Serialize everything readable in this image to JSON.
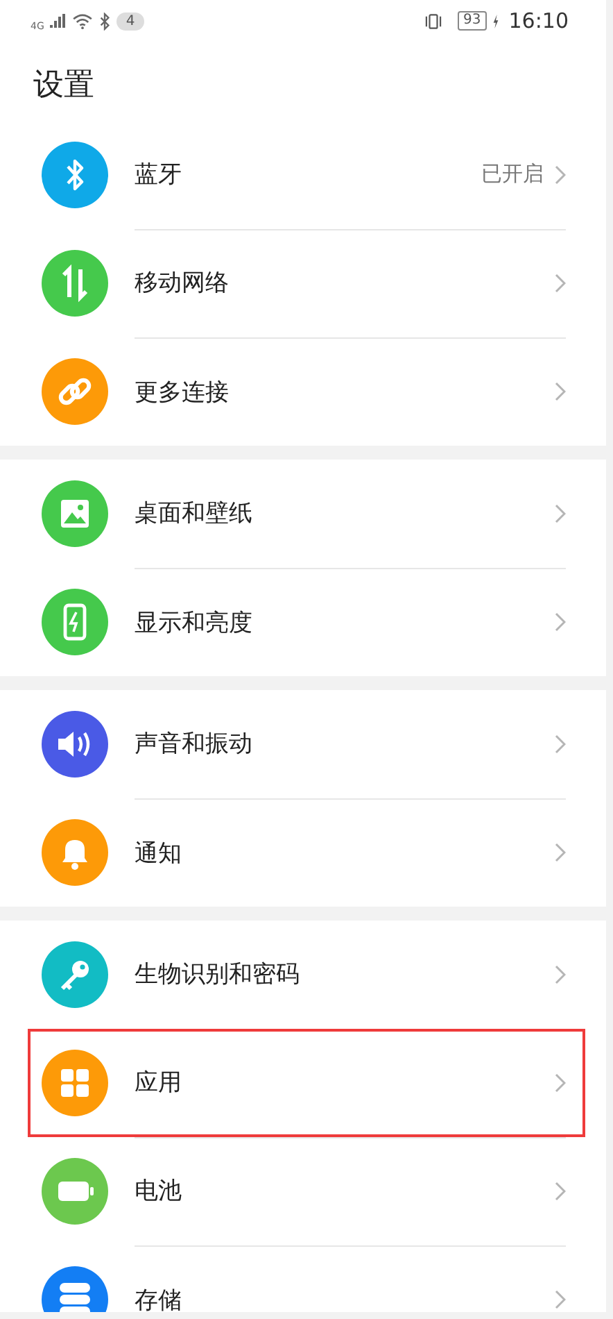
{
  "status_bar": {
    "network": "4G",
    "notification_count": "4",
    "battery": "93",
    "time": "16:10"
  },
  "title": "设置",
  "groups": [
    {
      "items": [
        {
          "label": "蓝牙",
          "value": "已开启",
          "kind": "bluetooth",
          "color": "#0fa9e8",
          "highlighted": false
        },
        {
          "label": "移动网络",
          "kind": "data",
          "color": "#45c94c",
          "highlighted": false
        },
        {
          "label": "更多连接",
          "kind": "link",
          "color": "#fd9a08",
          "highlighted": false
        }
      ]
    },
    {
      "items": [
        {
          "label": "桌面和壁纸",
          "kind": "image",
          "color": "#45c94c",
          "highlighted": false
        },
        {
          "label": "显示和亮度",
          "kind": "phone",
          "color": "#45c94c",
          "highlighted": false
        }
      ]
    },
    {
      "items": [
        {
          "label": "声音和振动",
          "kind": "sound",
          "color": "#4a5ae6",
          "highlighted": false
        },
        {
          "label": "通知",
          "kind": "bell",
          "color": "#fd9a08",
          "highlighted": false
        }
      ]
    },
    {
      "items": [
        {
          "label": "生物识别和密码",
          "kind": "key",
          "color": "#12bcc4",
          "highlighted": false
        },
        {
          "label": "应用",
          "kind": "apps",
          "color": "#fd9a08",
          "highlighted": true
        },
        {
          "label": "电池",
          "kind": "battery",
          "color": "#6cc84e",
          "highlighted": false
        },
        {
          "label": "存储",
          "kind": "storage",
          "color": "#137ef4",
          "highlighted": false
        }
      ]
    }
  ]
}
